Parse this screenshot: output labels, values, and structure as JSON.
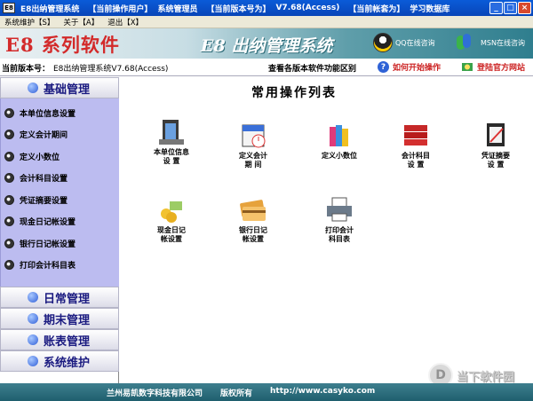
{
  "titlebar": {
    "app_icon": "E8",
    "title": "E8出纳管理系统",
    "current_user_label": "【当前操作用户】",
    "current_user": "系统管理员",
    "version_label": "【当前版本号为】",
    "version": "V7.68(Access)",
    "account_label": "【当前帐套为】",
    "account": "学习数据库",
    "min": "_",
    "max": "□",
    "close": "×"
  },
  "menu": [
    "系统维护【S】",
    "关于【A】",
    "退出【X】"
  ],
  "banner": {
    "brand": "E8 系列软件",
    "product": "E8 出纳管理系统",
    "qq_label": "QQ在线咨询",
    "msn_label": "MSN在线咨询"
  },
  "verbar": {
    "label": "当前版本号：",
    "value": "E8出纳管理系统V7.68(Access)",
    "compare": "查看各版本软件功能区别",
    "help": "如何开始操作",
    "site": "登陆官方网站"
  },
  "sidebar": {
    "sections": [
      "基础管理",
      "日常管理",
      "期末管理",
      "账表管理",
      "系统维护"
    ],
    "items": [
      "本单位信息设置",
      "定义会计期间",
      "定义小数位",
      "会计科目设置",
      "凭证摘要设置",
      "现金日记帐设置",
      "银行日记帐设置",
      "打印会计科目表"
    ]
  },
  "main": {
    "title": "常用操作列表",
    "ops": [
      {
        "line1": "本单位信息",
        "line2": "设  置",
        "icon": "company-info-icon"
      },
      {
        "line1": "定义会计",
        "line2": "期  间",
        "icon": "calendar-icon"
      },
      {
        "line1": "定义小数位",
        "line2": "",
        "icon": "books-icon"
      },
      {
        "line1": "会计科目",
        "line2": "设  置",
        "icon": "ledger-icon"
      },
      {
        "line1": "凭证摘要",
        "line2": "设  置",
        "icon": "voucher-icon"
      },
      {
        "line1": "现金日记",
        "line2": "帐设置",
        "icon": "cash-icon"
      },
      {
        "line1": "银行日记",
        "line2": "帐设置",
        "icon": "bank-card-icon"
      },
      {
        "line1": "打印会计",
        "line2": "科目表",
        "icon": "printer-icon"
      }
    ]
  },
  "footer": {
    "company": "兰州易凯数字科技有限公司",
    "rights": "版权所有",
    "url": "http://www.casyko.com"
  },
  "watermark": {
    "text": "当下软件园",
    "logo": "D"
  }
}
